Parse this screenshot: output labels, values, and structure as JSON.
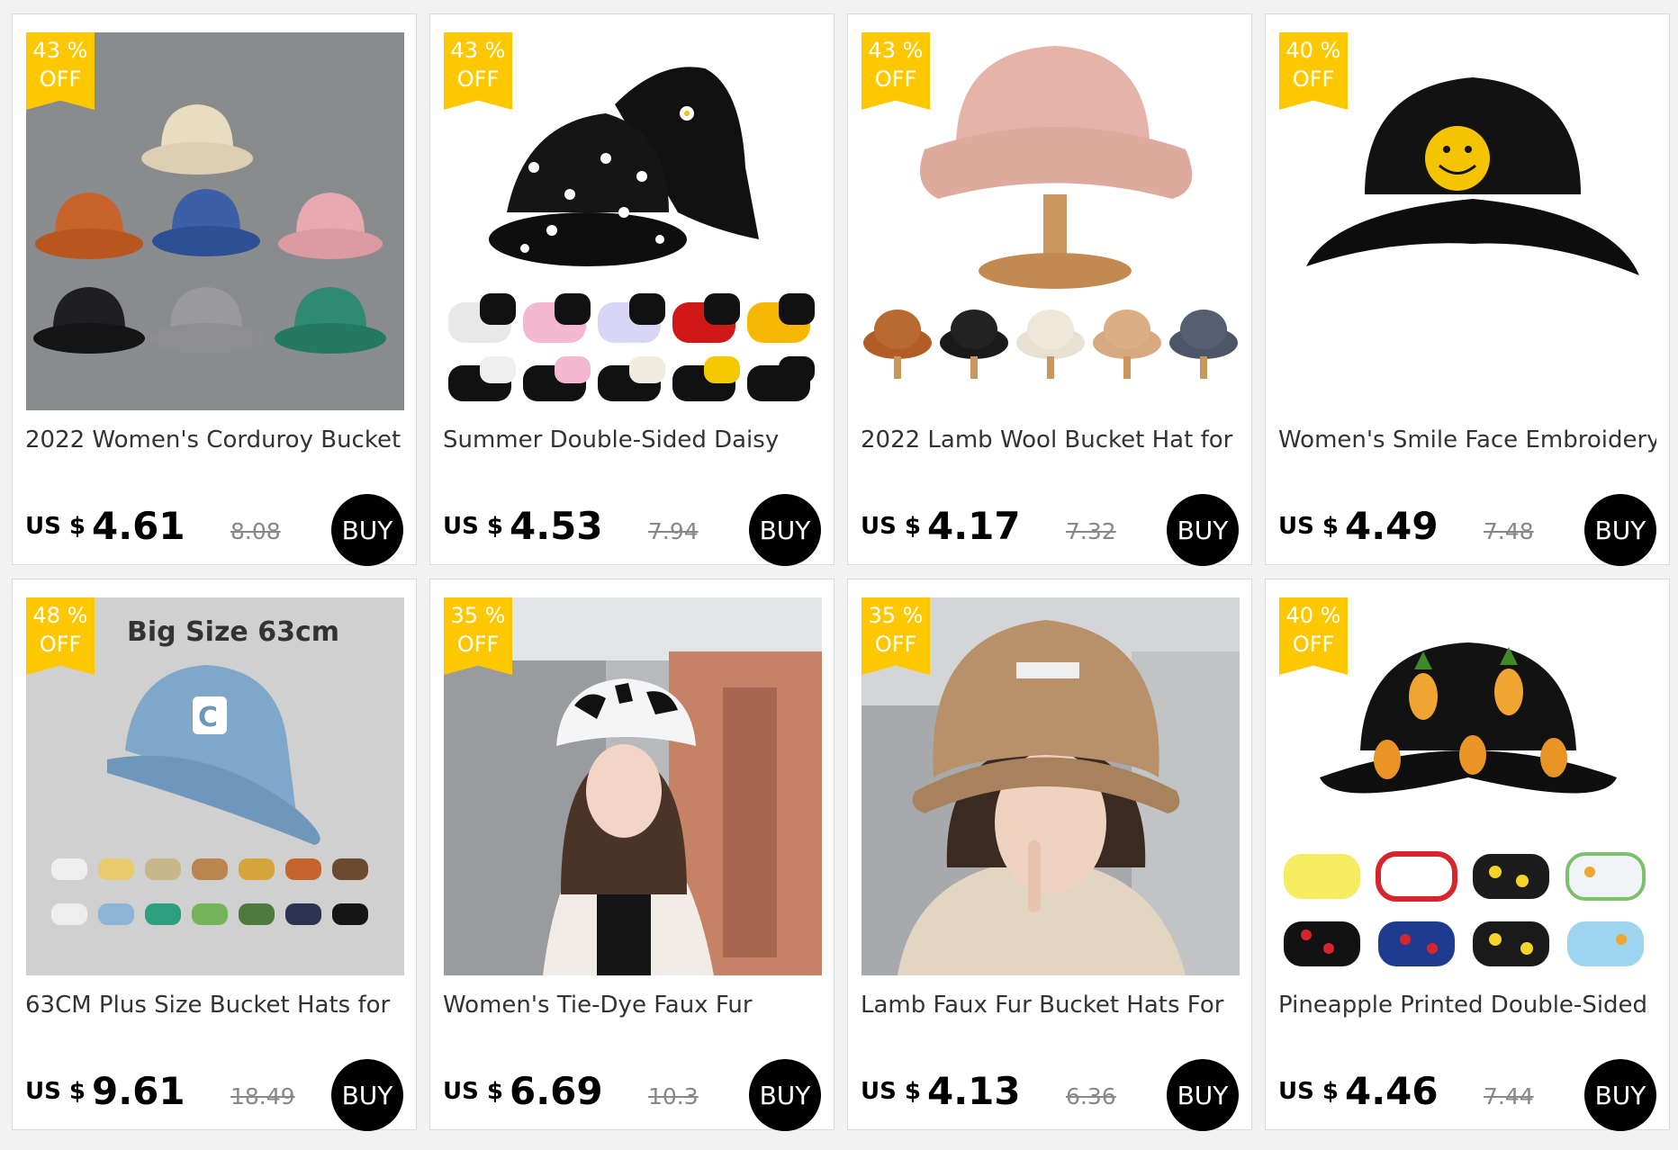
{
  "products": [
    {
      "discount_pct": "43 %",
      "discount_off": "OFF",
      "title": "2022 Women's Corduroy Bucket",
      "currency": "US $",
      "price": "4.61",
      "original_price": "8.08",
      "buy_label": "BUY"
    },
    {
      "discount_pct": "43 %",
      "discount_off": "OFF",
      "title": "Summer Double-Sided Daisy",
      "currency": "US $",
      "price": "4.53",
      "original_price": "7.94",
      "buy_label": "BUY"
    },
    {
      "discount_pct": "43 %",
      "discount_off": "OFF",
      "title": "2022 Lamb Wool Bucket Hat for",
      "currency": "US $",
      "price": "4.17",
      "original_price": "7.32",
      "buy_label": "BUY"
    },
    {
      "discount_pct": "40 %",
      "discount_off": "OFF",
      "title": "Women's Smile Face Embroidery",
      "currency": "US $",
      "price": "4.49",
      "original_price": "7.48",
      "buy_label": "BUY"
    },
    {
      "discount_pct": "48 %",
      "discount_off": "OFF",
      "title": "63CM Plus Size Bucket Hats for",
      "currency": "US $",
      "price": "9.61",
      "original_price": "18.49",
      "buy_label": "BUY",
      "image_caption": "Big Size  63cm"
    },
    {
      "discount_pct": "35 %",
      "discount_off": "OFF",
      "title": "Women's Tie-Dye Faux Fur",
      "currency": "US $",
      "price": "6.69",
      "original_price": "10.3",
      "buy_label": "BUY"
    },
    {
      "discount_pct": "35 %",
      "discount_off": "OFF",
      "title": "Lamb Faux Fur Bucket Hats For",
      "currency": "US $",
      "price": "4.13",
      "original_price": "6.36",
      "buy_label": "BUY"
    },
    {
      "discount_pct": "40 %",
      "discount_off": "OFF",
      "title": "Pineapple Printed Double-Sided",
      "currency": "US $",
      "price": "4.46",
      "original_price": "7.44",
      "buy_label": "BUY"
    }
  ],
  "colors": {
    "badge": "#fdc800",
    "buy_button": "#000000",
    "card_border": "#dadada"
  }
}
